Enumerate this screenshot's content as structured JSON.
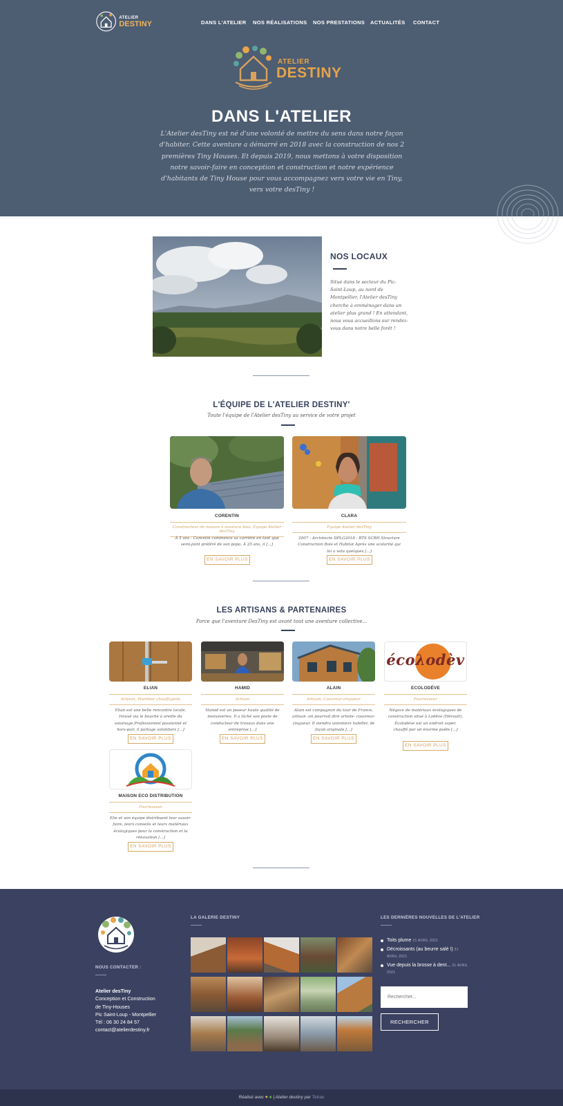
{
  "nav": {
    "logo_text_1": "ATELIER",
    "logo_text_2": "DESTINY",
    "items": [
      "DANS L'ATELIER",
      "NOS RÉALISATIONS",
      "NOS PRESTATIONS",
      "ACTUALITÉS",
      "CONTACT"
    ]
  },
  "hero": {
    "logo_text_1": "ATELIER",
    "logo_text_2": "DESTINY",
    "title": "DANS L'ATELIER",
    "text": "L'Atelier desTiny est né d'une volonté de mettre du sens dans notre façon d'habiter. Cette aventure a démarré en 2018 avec la construction de nos 2 premières Tiny Houses. Et depuis 2019, nous mettons à votre disposition notre savoir-faire en conception et construction et notre expérience d'habitants de Tiny House pour vous accompagnez vers votre vie en Tiny, vers votre desTiny !"
  },
  "locaux": {
    "title": "NOS LOCAUX",
    "text": "Situé dans le secteur du Pic-Saint-Loup, au nord de Montpellier, l'Atelier desTiny cherche à emménager dans un atelier plus grand ! En attendant, nous vous accueillons sur rendez-vous dans notre belle forêt !"
  },
  "equipe": {
    "title": "L'ÉQUIPE DE L'ATELIER DESTINY'",
    "subtitle": "Toute l'équipe de l'Atelier desTiny au service de votre projet",
    "members": [
      {
        "name": "CORENTIN",
        "role": "Constructeur de maison à ossature bois, Équipe Atelier desTiny",
        "desc": "À 5 ans : Corentin commence sa carrière en tant que semi-joint préféré de son papa. À 25 ans, il [...]",
        "button": "EN SAVOIR PLUS"
      },
      {
        "name": "CLARA",
        "role": "Équipe Atelier desTiny",
        "desc": "2007 : Architecte DPLG2018 : BTS SCBH Structure Construction Bois et Habitat Après une scolarité qui lui a valu quelques [...]",
        "button": "EN SAVOIR PLUS"
      }
    ]
  },
  "artisans": {
    "title": "LES ARTISANS & PARTENAIRES",
    "subtitle": "Parce que l'aventure DesTiny est avant tout une aventure collective...",
    "items": [
      {
        "name": "ELIAN",
        "role": "Artisan, Plombier chauffagiste",
        "desc": "Elian est une belle rencontre locale, trouvé via le bouche à oreille du voisinage.Professionnel passionné et hors-pair, il partage volontiers [...]",
        "button": "EN SAVOIR PLUS"
      },
      {
        "name": "HAMID",
        "role": "Artisan",
        "desc": "Hamid est un poseur haute qualité de menuiseries. Il a lâché son poste de conducteur de travaux dans une entreprise [...]",
        "button": "EN SAVOIR PLUS"
      },
      {
        "name": "ALAIN",
        "role": "Artisan, Couvreur-zingueur",
        "desc": "Alain est compagnon du tour de France, artisan -on pourrait dire artiste- couvreur-zingueur. Il viendra volontiers habiller, de façon originale [...]",
        "button": "EN SAVOIR PLUS"
      },
      {
        "name": "ECOLODÈVE",
        "role": "Fournisseur",
        "desc": "Négoce de matériaux écologiques de construction situé à Lodève (Hérault), Écolodève est un endroit super, chauffé par un énorme poêle [...]",
        "button": "EN SAVOIR PLUS",
        "logo_text": "écoλodèv"
      },
      {
        "name": "MAISON ECO DISTRIBUTION",
        "role": "Fournisseur",
        "desc": "Elie et son équipe distribuent leur savoir-faire, leurs conseils et leurs matériaux écologiques pour la construction et la rénovation [...]",
        "button": "EN SAVOIR PLUS"
      }
    ]
  },
  "footer": {
    "contact_heading": "NOUS CONTACTER :",
    "contact_name": "Atelier desTiny",
    "contact_lines": [
      "Conception et Construction",
      "de Tiny-Houses",
      "Pic Saint-Loup - Montpellier",
      "Tél : 06 30 24 84 57",
      "contact@atelierdestiny.fr"
    ],
    "gallery_heading": "LA GALERIE DESTINY",
    "news_heading": "LES DERNIÈRES NOUVELLES DE L'ATELIER",
    "news": [
      {
        "title": "Toits plume",
        "date": "21 AVRIL 2021"
      },
      {
        "title": "Décroissants (au beurre salé !)",
        "date": "31 AVRIL 2021"
      },
      {
        "title": "Vue depuis la brosse à dent...",
        "date": "31 AVRIL 2021"
      }
    ],
    "search_placeholder": "Rechercher...",
    "search_button": "RECHERCHER",
    "bottom_prefix": "Réalisé avec",
    "bottom_suffix": "| Atelier destiny par",
    "bottom_author": "Tetrao"
  },
  "colors": {
    "hero_bg": "#4d5d72",
    "accent": "#d2a05d",
    "navy": "#36405a",
    "footer_bg": "#3b4160"
  }
}
